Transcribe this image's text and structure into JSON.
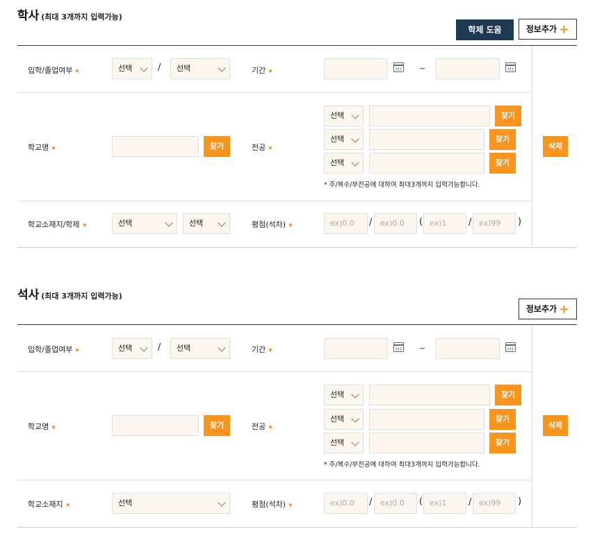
{
  "section1": {
    "title": "학사",
    "note": "(최대 3개까지 입력가능)",
    "help_button": "학제 도움말",
    "add_button": "정보추가",
    "labels": {
      "admission": "입학/졸업여부",
      "period": "기간",
      "school": "학교명",
      "major": "전공",
      "location": "학교소재지/학제",
      "gpa": "평점(석차)"
    },
    "selects": {
      "admission_1": "선택",
      "admission_2": "선택",
      "major_1": "선택",
      "major_2": "선택",
      "major_3": "선택",
      "location": "선택",
      "system": "선택"
    },
    "placeholders": {
      "gpa": "ex)0.0",
      "gpa_max": "ex)0.0",
      "rank": "ex)1",
      "rank_total": "ex)99"
    },
    "find_label": "찾기",
    "delete_label": "삭제",
    "major_hint": "* 주/복수/부전공에 대하여 최대3개까지 입력가능합니다.",
    "sep_slash": "/",
    "sep_tilde": "~",
    "paren_open": "(",
    "paren_close": ")"
  },
  "section2": {
    "title": "석사",
    "note": "(최대 3개까지 입력가능)",
    "add_button": "정보추가",
    "labels": {
      "admission": "입학/졸업여부",
      "period": "기간",
      "school": "학교명",
      "major": "전공",
      "location": "학교소재지",
      "gpa": "평점(석차)"
    },
    "selects": {
      "admission_1": "선택",
      "admission_2": "선택",
      "major_1": "선택",
      "major_2": "선택",
      "major_3": "선택",
      "location": "선택"
    },
    "placeholders": {
      "gpa": "ex)0.0",
      "gpa_max": "ex)0.0",
      "rank": "ex)1",
      "rank_total": "ex)99"
    },
    "find_label": "찾기",
    "delete_label": "삭제",
    "major_hint": "* 주/복수/부전공에 대하여 최대3개까지 입력가능합니다.",
    "sep_slash": "/",
    "sep_tilde": "~",
    "paren_open": "(",
    "paren_close": ")"
  },
  "colors": {
    "accent": "#f7941d",
    "help_button_bg": "#1e3a52",
    "input_bg": "#fdf6ef"
  }
}
